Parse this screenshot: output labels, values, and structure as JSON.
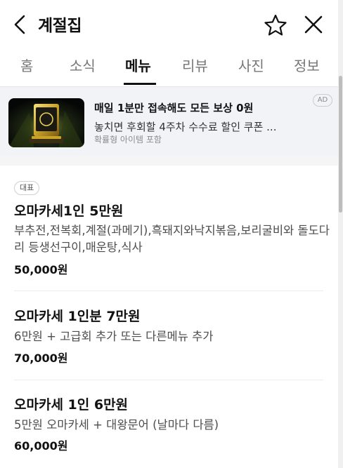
{
  "header": {
    "title": "계절집",
    "back_icon": "chevron-left-icon",
    "favorite_icon": "star-outline-icon",
    "close_icon": "close-icon"
  },
  "tabs": [
    {
      "label": "홈",
      "active": false
    },
    {
      "label": "소식",
      "active": false
    },
    {
      "label": "메뉴",
      "active": true
    },
    {
      "label": "리뷰",
      "active": false
    },
    {
      "label": "사진",
      "active": false
    },
    {
      "label": "정보",
      "active": false
    }
  ],
  "ad": {
    "headline": "매일 1분만 접속해도 모든 보상 0원",
    "description": "놓치면 후회할 4주차 수수료 할인 쿠폰 ...",
    "note": "확률형 아이템 포함",
    "badge": "AD"
  },
  "menu": {
    "representative_badge": "대표",
    "items": [
      {
        "name": "오마카세1인 5만원",
        "description": "부추전,전복회,계절(과메기),흑돼지와낙지볶음,보리굴비와 돌도다리 등생선구이,매운탕,식사",
        "price": "50,000원"
      },
      {
        "name": "오마카세 1인분 7만원",
        "description": "6만원 + 고급회 추가 또는 다른메뉴 추가",
        "price": "70,000원"
      },
      {
        "name": "오마카세 1인 6만원",
        "description": "5만원 오마카세 + 대왕문어 (날마다 다름)",
        "price": "60,000원"
      }
    ]
  },
  "colors": {
    "text_primary": "#111111",
    "text_secondary": "#4d4d4d",
    "ad_background": "#f1f3f7",
    "active_underline": "#111111"
  }
}
